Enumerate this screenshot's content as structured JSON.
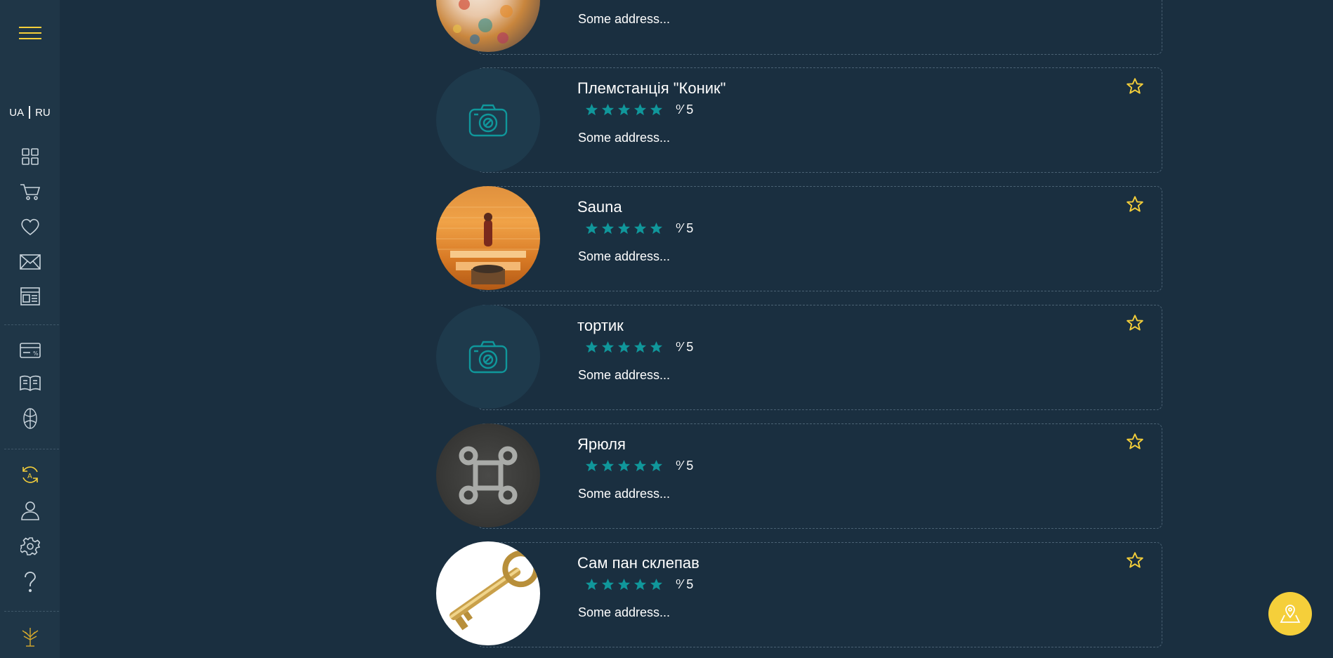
{
  "sidebar": {
    "lang": {
      "ua": "UA",
      "ru": "RU"
    },
    "icons": [
      "menu-icon",
      "grid-icon",
      "cart-icon",
      "heart-icon",
      "mail-icon",
      "newspaper-icon",
      "discount-card-icon",
      "book-icon",
      "flower-icon",
      "sync-icon",
      "user-icon",
      "gear-icon",
      "help-icon",
      "tree-logo-icon"
    ]
  },
  "colors": {
    "accent_yellow": "#f5cf3a",
    "star_teal": "#10979b",
    "background": "#1a2f40",
    "sidebar": "#1f3647"
  },
  "listings": [
    {
      "title": "",
      "rating": "⁰⁄ 5",
      "address": "Some address...",
      "image": "photo-person"
    },
    {
      "title": "Племстанція \"Коник\"",
      "rating": "⁰⁄ 5",
      "address": "Some address...",
      "image": "camera-icon"
    },
    {
      "title": "Sauna",
      "rating": "⁰⁄ 5",
      "address": "Some address...",
      "image": "photo-sauna"
    },
    {
      "title": "тортик",
      "rating": "⁰⁄ 5",
      "address": "Some address...",
      "image": "camera-icon"
    },
    {
      "title": "Ярюля",
      "rating": "⁰⁄ 5",
      "address": "Some address...",
      "image": "command-key-icon"
    },
    {
      "title": "Сам пан склепав",
      "rating": "⁰⁄ 5",
      "address": "Some address...",
      "image": "photo-keys"
    }
  ],
  "map_button": {
    "icon": "map-pin-icon"
  }
}
